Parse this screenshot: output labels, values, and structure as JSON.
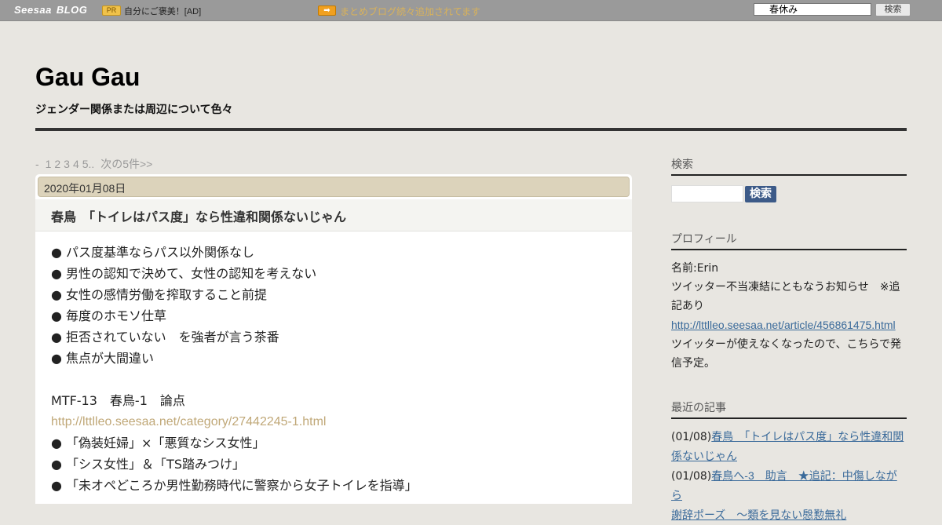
{
  "topbar": {
    "logo_seesaa": "Seesaa",
    "logo_blog": "BLOG",
    "pr_badge": "PR",
    "pr_text": "自分にご褒美！[AD]",
    "arrow_badge": "➡",
    "notice": "まとめブログ続々追加されてます",
    "search_value": "春休み",
    "search_button": "検索"
  },
  "header": {
    "title": "Gau Gau",
    "description": "ジェンダー関係または周辺について色々"
  },
  "pager": {
    "dash": "-",
    "pages": [
      "1",
      "2",
      "3",
      "4",
      "5.."
    ],
    "next": "次の5件>>"
  },
  "article": {
    "date": "2020年01月08日",
    "title": "春鳥　「トイレはパス度」なら性違和関係ないじゃん",
    "lines": [
      "● パス度基準ならパス以外関係なし",
      "● 男性の認知で決めて、女性の認知を考えない",
      "● 女性の感情労働を搾取すること前提",
      "● 毎度のホモソ仕草",
      "● 拒否されていない　を強者が言う茶番",
      "● 焦点が大間違い",
      "",
      "MTF-13　春鳥-1　論点",
      "http://lttlleo.seesaa.net/category/27442245-1.html",
      "● 「偽装妊婦」×「悪質なシス女性」",
      "● 「シス女性」＆「TS踏みつけ」",
      "● 「未オペどころか男性勤務時代に警察から女子トイレを指導」"
    ]
  },
  "sidebar": {
    "search": {
      "heading": "検索",
      "button": "検索"
    },
    "profile": {
      "heading": "プロフィール",
      "name": "名前:Erin",
      "notice_1": "ツイッター不当凍結にともなうお知らせ　※追",
      "notice_2": "記あり",
      "link": "http://lttlleo.seesaa.net/article/456861475.html",
      "text_1": "ツイッターが使えなくなったので、こちらで発",
      "text_2": "信予定。"
    },
    "recent": {
      "heading": "最近の記事",
      "items": [
        {
          "date": "(01/08)",
          "title_1": "春鳥　「トイレはパス度」なら性違和関",
          "title_2": "係ないじゃん"
        },
        {
          "date": "(01/08)",
          "title_1": "春鳥へ-3　助言　★追記：中傷しながら",
          "title_2": "謝辞ポーズ　～類を見ない慇懃無礼"
        }
      ]
    }
  },
  "colors": {
    "background": "#e8e6e1",
    "topbar": "#9a9a9a",
    "date_bar": "#dcd3bb",
    "body_link": "#c0a878",
    "sidebar_link": "#3a6a9a",
    "search_button": "#3c5a88"
  }
}
